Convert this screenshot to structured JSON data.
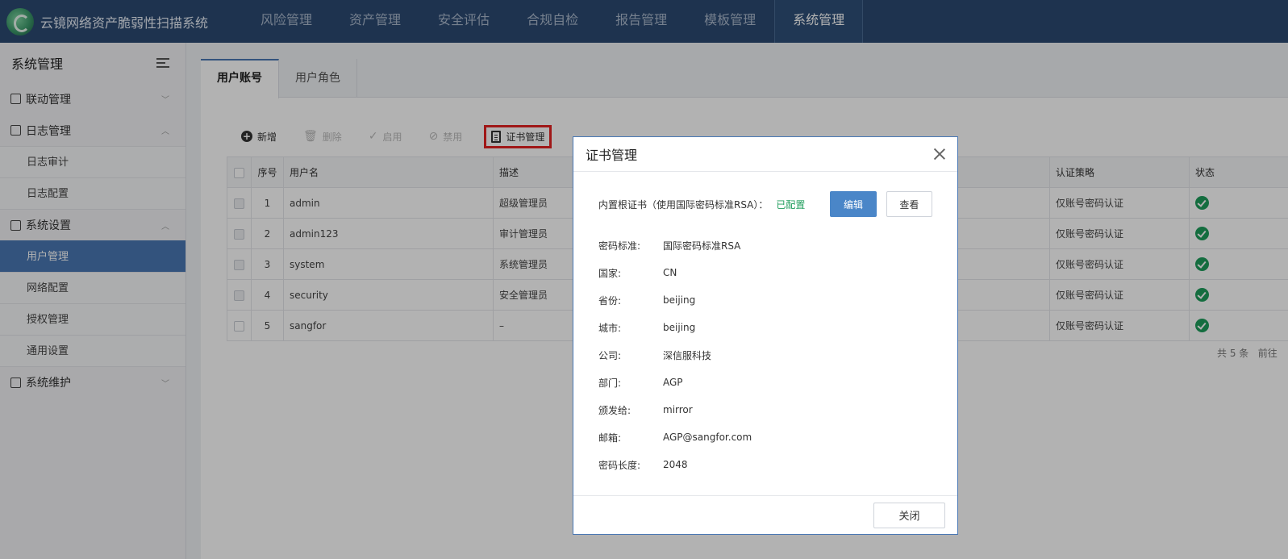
{
  "app": {
    "title": "云镜网络资产脆弱性扫描系统"
  },
  "nav": [
    "风险管理",
    "资产管理",
    "安全评估",
    "合规自检",
    "报告管理",
    "模板管理",
    "系统管理"
  ],
  "sidebar": {
    "title": "系统管理",
    "groups": [
      {
        "label": "联动管理",
        "expanded": false,
        "items": []
      },
      {
        "label": "日志管理",
        "expanded": true,
        "items": [
          "日志审计",
          "日志配置"
        ]
      },
      {
        "label": "系统设置",
        "expanded": true,
        "items": [
          "用户管理",
          "网络配置",
          "授权管理",
          "通用设置"
        ],
        "active_item": "用户管理"
      },
      {
        "label": "系统维护",
        "expanded": false,
        "items": []
      }
    ]
  },
  "tabs": [
    "用户账号",
    "用户角色"
  ],
  "toolbar": {
    "add": "新增",
    "delete": "删除",
    "enable": "启用",
    "disable": "禁用",
    "cert": "证书管理"
  },
  "table": {
    "columns": [
      "序号",
      "用户名",
      "描述",
      "认证策略",
      "状态"
    ],
    "rows": [
      {
        "no": "1",
        "user": "admin",
        "desc": "超级管理员",
        "auth": "仅账号密码认证",
        "status": "enabled"
      },
      {
        "no": "2",
        "user": "admin123",
        "desc": "审计管理员",
        "auth": "仅账号密码认证",
        "status": "enabled"
      },
      {
        "no": "3",
        "user": "system",
        "desc": "系统管理员",
        "auth": "仅账号密码认证",
        "status": "enabled"
      },
      {
        "no": "4",
        "user": "security",
        "desc": "安全管理员",
        "auth": "仅账号密码认证",
        "status": "enabled"
      },
      {
        "no": "5",
        "user": "sangfor",
        "desc": "–",
        "auth": "仅账号密码认证",
        "status": "enabled"
      }
    ]
  },
  "pager": {
    "total": "共 5 条",
    "goto": "前往"
  },
  "modal": {
    "title": "证书管理",
    "root_label": "内置根证书（使用国际密码标准RSA）：",
    "root_status": "已配置",
    "edit": "编辑",
    "view": "查看",
    "fields": [
      {
        "k": "密码标准:",
        "v": "国际密码标准RSA"
      },
      {
        "k": "国家:",
        "v": "CN"
      },
      {
        "k": "省份:",
        "v": "beijing"
      },
      {
        "k": "城市:",
        "v": "beijing"
      },
      {
        "k": "公司:",
        "v": "深信服科技"
      },
      {
        "k": "部门:",
        "v": "AGP"
      },
      {
        "k": "颁发给:",
        "v": "mirror"
      },
      {
        "k": "邮箱:",
        "v": "AGP@sangfor.com"
      },
      {
        "k": "密码长度:",
        "v": "2048"
      }
    ],
    "close": "关闭"
  }
}
